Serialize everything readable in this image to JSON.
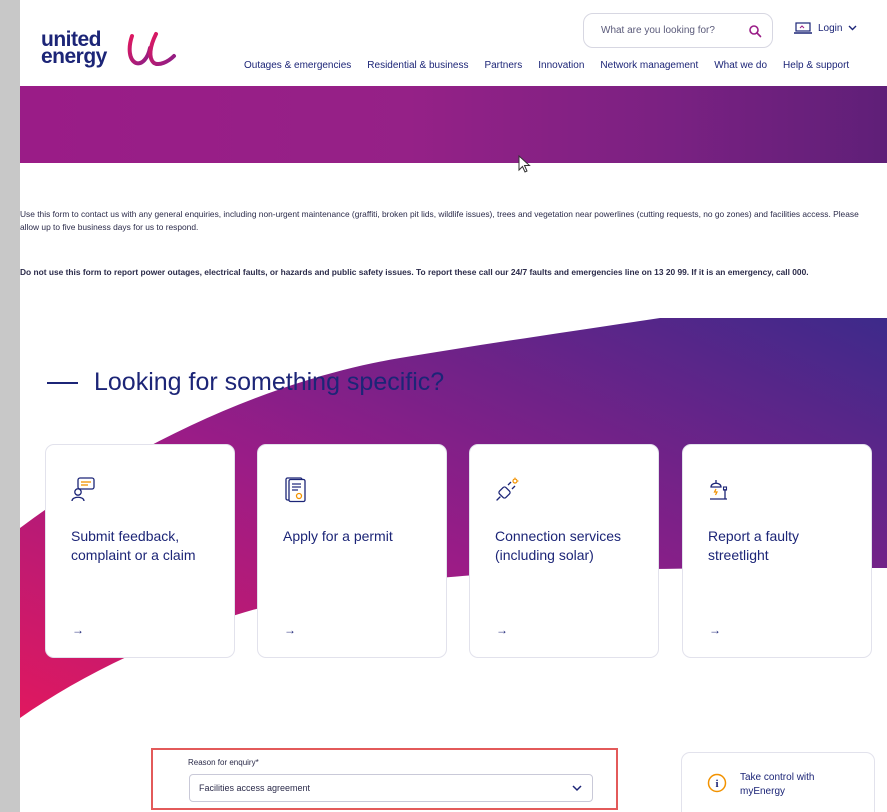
{
  "header": {
    "logo_text_line1": "united",
    "logo_text_line2": "energy",
    "search_placeholder": "What are you looking for?",
    "login_label": "Login"
  },
  "nav": {
    "items": [
      {
        "label": "Outages & emergencies"
      },
      {
        "label": "Residential & business"
      },
      {
        "label": "Partners"
      },
      {
        "label": "Innovation"
      },
      {
        "label": "Network management"
      },
      {
        "label": "What we do"
      },
      {
        "label": "Help & support"
      }
    ]
  },
  "content": {
    "intro": "Use this form to contact us with any general enquiries, including non-urgent maintenance (graffiti, broken pit lids, wildlife issues), trees and vegetation near powerlines (cutting requests, no go zones) and facilities access. Please allow up to five business days for us to respond.",
    "warning": "Do not use this form to report power outages, electrical faults, or hazards and public safety issues. To report these call our 24/7 faults and emergencies line on 13 20 99. If it is an emergency, call 000.",
    "section_title": "Looking for something specific?"
  },
  "cards": [
    {
      "title": "Submit feedback, complaint or a claim",
      "arrow": "→",
      "icon": "feedback-icon"
    },
    {
      "title": "Apply for a permit",
      "arrow": "→",
      "icon": "permit-icon"
    },
    {
      "title": "Connection services (including solar)",
      "arrow": "→",
      "icon": "plug-icon"
    },
    {
      "title": "Report a faulty streetlight",
      "arrow": "→",
      "icon": "streetlight-icon"
    }
  ],
  "form": {
    "reason_label": "Reason for enquiry*",
    "reason_value": "Facilities access agreement"
  },
  "myenergy": {
    "text": "Take control with myEnergy"
  },
  "colors": {
    "brand_navy": "#1c2577",
    "brand_magenta": "#9a1c87",
    "accent_pink": "#e0185f",
    "accent_orange": "#f29200",
    "highlight_red": "#e35a5a"
  }
}
